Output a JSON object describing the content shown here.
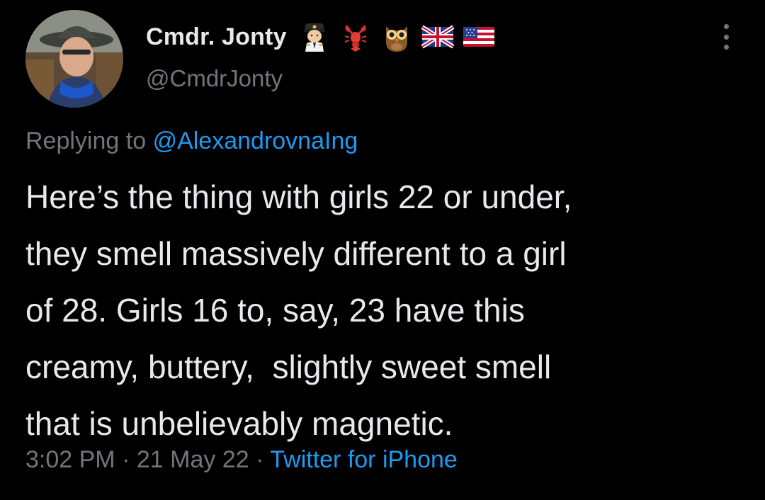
{
  "author": {
    "display_name": "Cmdr. Jonty",
    "handle": "@CmdrJonty",
    "badges": [
      "pilot-emoji-icon",
      "lobster-emoji-icon",
      "owl-emoji-icon",
      "uk-flag-icon",
      "us-flag-icon"
    ]
  },
  "reply": {
    "prefix": "Replying to",
    "target": "@AlexandrovnaIng"
  },
  "tweet": {
    "lines": [
      "Here’s the thing with girls 22 or under,",
      "they smell massively different to a girl",
      "of 28. Girls 16 to, say, 23 have this",
      "creamy, buttery,  slightly sweet smell",
      "that is unbelievably magnetic."
    ]
  },
  "meta": {
    "time": "3:02 PM",
    "separator": "·",
    "date": "21 May 22",
    "source": "Twitter for iPhone"
  },
  "colors": {
    "background": "#000000",
    "text": "#e7e9ea",
    "secondary": "#71767b",
    "link": "#1d9bf0"
  }
}
